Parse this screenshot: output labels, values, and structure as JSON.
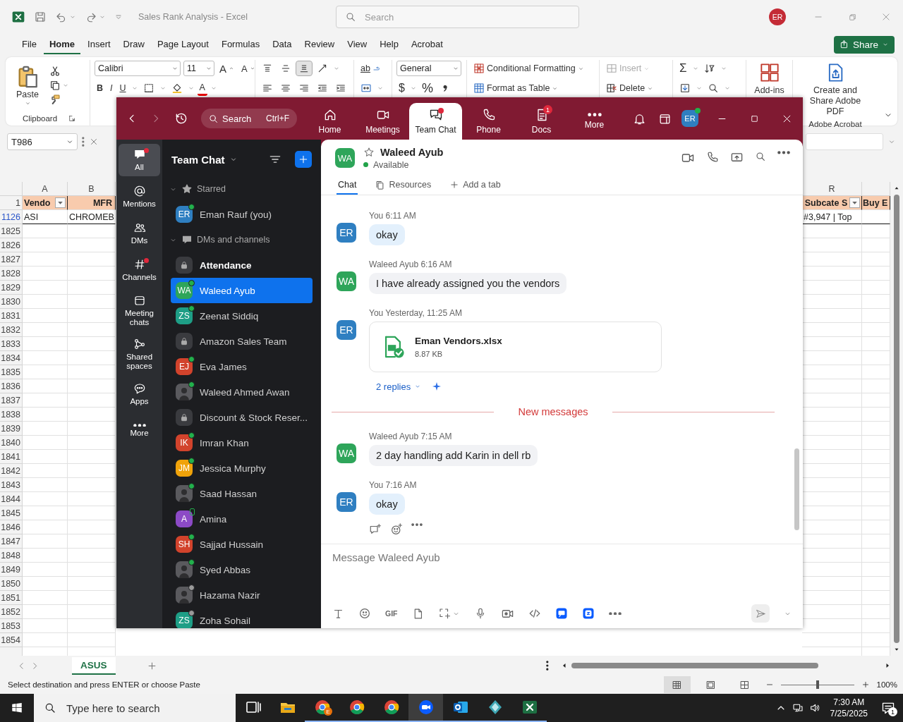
{
  "excel": {
    "title": "Sales Rank Analysis - Excel",
    "search": {
      "placeholder": "Search"
    },
    "account": "ER",
    "menu": [
      {
        "label": "File",
        "selected": false
      },
      {
        "label": "Home",
        "selected": true
      },
      {
        "label": "Insert",
        "selected": false
      },
      {
        "label": "Draw",
        "selected": false
      },
      {
        "label": "Page Layout",
        "selected": false
      },
      {
        "label": "Formulas",
        "selected": false
      },
      {
        "label": "Data",
        "selected": false
      },
      {
        "label": "Review",
        "selected": false
      },
      {
        "label": "View",
        "selected": false
      },
      {
        "label": "Help",
        "selected": false
      },
      {
        "label": "Acrobat",
        "selected": false
      }
    ],
    "share": "Share",
    "ribbon": {
      "paste": "Paste",
      "clipboard": "Clipboard",
      "font": "Calibri",
      "font_size": "11",
      "grow_font": "A",
      "shrink_font": "A",
      "bold": "B",
      "italic": "I",
      "underline": "U",
      "font_color": "A",
      "alignment": [
        {
          "selected": false
        },
        {
          "selected": false
        },
        {
          "selected": true
        }
      ],
      "wrap_text": "ab",
      "number_format": "General",
      "currency": "$",
      "percent": "%",
      "conditional_formatting": "Conditional Formatting",
      "format_as_table": "Format as Table",
      "insert": {
        "label": "Insert",
        "disabled": true
      },
      "delete": "Delete",
      "autosum": "Σ",
      "add_ins": "Add-ins",
      "create_pdf": "Create and Share Adobe PDF",
      "acrobat": "Adobe Acrobat"
    },
    "name_box": "T986",
    "grid": {
      "header_row_number": "1",
      "columns": [
        {
          "letter": "A",
          "heading": "Vendo",
          "filter": true
        },
        {
          "letter": "B",
          "heading": "MFR"
        },
        {
          "letter": "R",
          "heading": "Subcate S",
          "filter": true
        },
        {
          "heading": "Buy E",
          "filter": false
        }
      ],
      "rows": [
        {
          "number": "1126",
          "filtered": true,
          "cells": [
            "ASI",
            "CHROMEB",
            "#3,947 | Top"
          ]
        },
        {
          "number": "1825",
          "filtered": false
        },
        {
          "number": "1826",
          "filtered": false
        },
        {
          "number": "1827",
          "filtered": false
        },
        {
          "number": "1828",
          "filtered": false
        },
        {
          "number": "1829",
          "filtered": false
        },
        {
          "number": "1830",
          "filtered": false
        },
        {
          "number": "1831",
          "filtered": false
        },
        {
          "number": "1832",
          "filtered": false
        },
        {
          "number": "1833",
          "filtered": false
        },
        {
          "number": "1834",
          "filtered": false
        },
        {
          "number": "1835",
          "filtered": false
        },
        {
          "number": "1836",
          "filtered": false
        },
        {
          "number": "1837",
          "filtered": false
        },
        {
          "number": "1838",
          "filtered": false
        },
        {
          "number": "1839",
          "filtered": false
        },
        {
          "number": "1840",
          "filtered": false
        },
        {
          "number": "1841",
          "filtered": false
        },
        {
          "number": "1842",
          "filtered": false
        },
        {
          "number": "1843",
          "filtered": false
        },
        {
          "number": "1844",
          "filtered": false
        },
        {
          "number": "1845",
          "filtered": false
        },
        {
          "number": "1846",
          "filtered": false
        },
        {
          "number": "1847",
          "filtered": false
        },
        {
          "number": "1848",
          "filtered": false
        },
        {
          "number": "1849",
          "filtered": false
        },
        {
          "number": "1850",
          "filtered": false
        },
        {
          "number": "1851",
          "filtered": false
        },
        {
          "number": "1852",
          "filtered": false
        },
        {
          "number": "1853",
          "filtered": false
        },
        {
          "number": "1854",
          "filtered": false
        }
      ]
    },
    "sheets": [
      {
        "label": "ASUS",
        "selected": true
      }
    ],
    "status": "Select destination and press ENTER or choose Paste",
    "views": [
      {
        "selected": true
      },
      {
        "selected": false
      },
      {
        "selected": false
      }
    ],
    "zoom": {
      "level": 0.5,
      "label": "100%"
    }
  },
  "zoom_app": {
    "search": {
      "placeholder": "Search"
    },
    "shortcut": "Ctrl+F",
    "tabs": [
      {
        "label": "Home",
        "selected": false,
        "alert": false
      },
      {
        "label": "Meetings",
        "selected": false,
        "alert": false
      },
      {
        "label": "Team Chat",
        "selected": true,
        "alert": true
      },
      {
        "label": "Phone",
        "selected": false,
        "alert": false
      },
      {
        "label": "Docs",
        "selected": false,
        "alert": false,
        "badge": "1"
      },
      {
        "label": "More",
        "selected": false,
        "alert": false
      }
    ],
    "account": "ER",
    "rail": [
      {
        "label": "All",
        "selected": true,
        "alert": true
      },
      {
        "label": "Mentions",
        "selected": false,
        "alert": false
      },
      {
        "label": "DMs",
        "selected": false,
        "alert": false
      },
      {
        "label": "Channels",
        "selected": false,
        "alert": true
      },
      {
        "label": "Meeting chats",
        "selected": false,
        "alert": false
      },
      {
        "label": "Shared spaces",
        "selected": false,
        "alert": false
      },
      {
        "label": "Apps",
        "selected": false,
        "alert": false
      },
      {
        "label": "More",
        "selected": false,
        "alert": false
      }
    ],
    "list": {
      "title": "Team Chat",
      "sections": [
        {
          "label": "Starred",
          "expanded": true,
          "items": [
            {
              "kind": "person",
              "name": "Eman Rauf (you)",
              "initials": "ER",
              "color": "#2f7fc1",
              "online": true,
              "mobile": false,
              "away": false,
              "selected": false,
              "unread": false
            }
          ]
        },
        {
          "label": "DMs and channels",
          "expanded": true,
          "items": [
            {
              "kind": "channel",
              "name": "Attendance",
              "online": false,
              "mobile": false,
              "away": false,
              "selected": false,
              "unread": true
            },
            {
              "kind": "person",
              "name": "Waleed Ayub",
              "initials": "WA",
              "color": "#2ea55a",
              "online": true,
              "mobile": false,
              "away": false,
              "selected": true,
              "unread": false
            },
            {
              "kind": "person",
              "name": "Zeenat Siddiq",
              "initials": "ZS",
              "color": "#1e9e86",
              "online": true,
              "mobile": false,
              "away": false,
              "selected": false,
              "unread": false
            },
            {
              "kind": "channel",
              "name": "Amazon Sales Team",
              "online": false,
              "mobile": false,
              "away": false,
              "selected": false,
              "unread": false
            },
            {
              "kind": "person",
              "name": "Eva James",
              "initials": "EJ",
              "color": "#d2432c",
              "online": true,
              "mobile": false,
              "away": false,
              "selected": false,
              "unread": false
            },
            {
              "kind": "photo",
              "name": "Waleed Ahmed Awan",
              "online": true,
              "mobile": false,
              "away": false,
              "selected": false,
              "unread": false
            },
            {
              "kind": "channel",
              "name": "Discount & Stock Reser...",
              "online": false,
              "mobile": false,
              "away": false,
              "selected": false,
              "unread": false
            },
            {
              "kind": "person",
              "name": "Imran Khan",
              "initials": "IK",
              "color": "#d2432c",
              "online": true,
              "mobile": false,
              "away": false,
              "selected": false,
              "unread": false
            },
            {
              "kind": "person",
              "name": "Jessica Murphy",
              "initials": "JM",
              "color": "#f0a30a",
              "online": true,
              "mobile": false,
              "away": false,
              "selected": false,
              "unread": false
            },
            {
              "kind": "photo",
              "name": "Saad Hassan",
              "online": true,
              "mobile": false,
              "away": false,
              "selected": false,
              "unread": false
            },
            {
              "kind": "person",
              "name": "Amina",
              "initials": "A",
              "color": "#8c4ac6",
              "online": false,
              "mobile": true,
              "away": false,
              "selected": false,
              "unread": false
            },
            {
              "kind": "person",
              "name": "Sajjad Hussain",
              "initials": "SH",
              "color": "#d2432c",
              "online": true,
              "mobile": false,
              "away": false,
              "selected": false,
              "unread": false
            },
            {
              "kind": "photo",
              "name": "Syed Abbas",
              "online": true,
              "mobile": false,
              "away": false,
              "selected": false,
              "unread": false
            },
            {
              "kind": "photo",
              "name": "Hazama Nazir",
              "online": false,
              "mobile": false,
              "away": true,
              "selected": false,
              "unread": false
            },
            {
              "kind": "person",
              "name": "Zoha Sohail",
              "initials": "ZS",
              "color": "#1e9e86",
              "online": false,
              "mobile": false,
              "away": true,
              "selected": false,
              "unread": false
            }
          ]
        }
      ]
    },
    "chat": {
      "name": "Waleed Ayub",
      "initials": "WA",
      "color": "#2ea55a",
      "starred": false,
      "status": "Available",
      "tabs": [
        {
          "label": "Chat",
          "selected": true
        },
        {
          "label": "Resources",
          "selected": false
        },
        {
          "label": "Add a tab",
          "selected": false
        }
      ],
      "messages": [
        {
          "kind": "text",
          "sender": "You",
          "time": "6:11 AM",
          "initials": "ER",
          "color": "#2f7fc1",
          "mine": true,
          "hovered": false,
          "text": "okay"
        },
        {
          "kind": "text",
          "sender": "Waleed Ayub",
          "time": "6:16 AM",
          "initials": "WA",
          "color": "#2ea55a",
          "mine": false,
          "hovered": false,
          "text": "I have already assigned you the vendors"
        },
        {
          "kind": "file",
          "sender": "You",
          "time": "Yesterday, 11:25 AM",
          "initials": "ER",
          "color": "#2f7fc1",
          "mine": true,
          "hovered": false,
          "file_name": "Eman Vendors.xlsx",
          "file_size": "8.87 KB",
          "replies": "2 replies"
        },
        {
          "kind": "divider",
          "text": "New messages"
        },
        {
          "kind": "text",
          "sender": "Waleed Ayub",
          "time": "7:15 AM",
          "initials": "WA",
          "color": "#2ea55a",
          "mine": false,
          "hovered": false,
          "text": "2 day handling add Karin in dell rb"
        },
        {
          "kind": "text",
          "sender": "You",
          "time": "7:16 AM",
          "initials": "ER",
          "color": "#2f7fc1",
          "mine": true,
          "hovered": true,
          "text": "okay"
        }
      ],
      "compose": {
        "placeholder": "Message Waleed Ayub"
      },
      "gif": "GIF"
    }
  },
  "taskbar": {
    "search": {
      "placeholder": "Type here to search"
    },
    "apps": [
      {
        "running": false,
        "active": false
      },
      {
        "running": false,
        "active": false
      },
      {
        "running": true,
        "active": false,
        "profile": "E"
      },
      {
        "running": true,
        "active": false
      },
      {
        "running": true,
        "active": false
      },
      {
        "running": true,
        "active": true
      },
      {
        "running": true,
        "active": false
      },
      {
        "running": true,
        "active": false
      },
      {
        "running": true,
        "active": false
      }
    ],
    "time": "7:30 AM",
    "date": "7/25/2025",
    "notifications": "1"
  }
}
